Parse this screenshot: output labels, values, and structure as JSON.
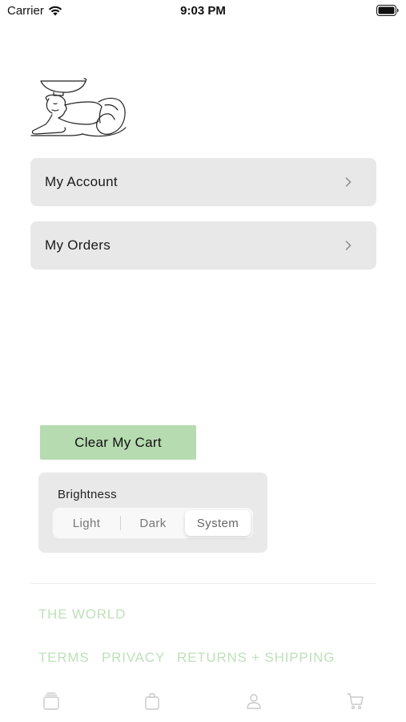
{
  "status_bar": {
    "carrier": "Carrier",
    "time": "9:03 PM"
  },
  "menu": {
    "items": [
      {
        "label": "My Account"
      },
      {
        "label": "My Orders"
      }
    ]
  },
  "cart": {
    "clear_label": "Clear My Cart"
  },
  "brightness": {
    "title": "Brightness",
    "options": [
      "Light",
      "Dark",
      "System"
    ],
    "selected": "System"
  },
  "footer": {
    "the_world": "THE WORLD",
    "terms": "TERMS",
    "privacy": "PRIVACY",
    "returns": "RETURNS + SHIPPING"
  },
  "tab_bar": {
    "icons": [
      "collection-icon",
      "bag-icon",
      "person-icon",
      "cart-icon"
    ]
  },
  "colors": {
    "accent_green": "#b6dbb0",
    "footer_link": "#bfe0ba",
    "row_background": "#e8e8e8"
  }
}
